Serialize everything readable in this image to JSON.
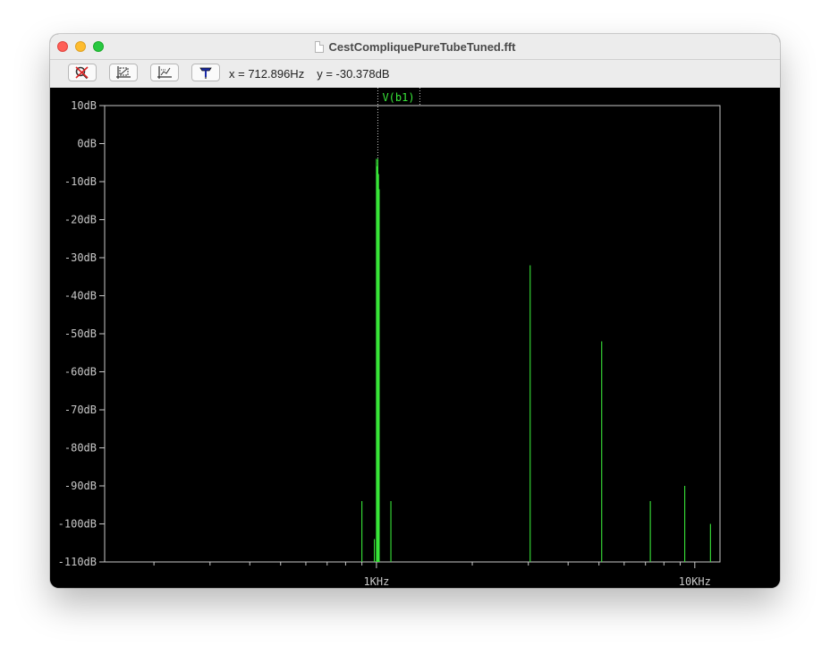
{
  "window": {
    "title": "CestCompliquePureTubeTuned.fft"
  },
  "toolbar": {
    "buttons": [
      {
        "icon": "zoom-cancel-icon"
      },
      {
        "icon": "autorange-icon"
      },
      {
        "icon": "zoom-fit-icon"
      },
      {
        "icon": "probe-icon"
      }
    ],
    "cursor_x": "x = 712.896Hz",
    "cursor_y": "y = -30.378dB"
  },
  "colors": {
    "background": "#000000",
    "trace": "#39e639",
    "axes": "#c8c8c8"
  },
  "chart_data": {
    "type": "bar",
    "title": "",
    "trace_label": "V(b1)",
    "xscale": "log",
    "xlim_hz": [
      140,
      12000
    ],
    "ylim_db": [
      -110,
      10
    ],
    "yticks": [
      {
        "value": 10,
        "label": "10dB"
      },
      {
        "value": 0,
        "label": "0dB"
      },
      {
        "value": -10,
        "label": "-10dB"
      },
      {
        "value": -20,
        "label": "-20dB"
      },
      {
        "value": -30,
        "label": "-30dB"
      },
      {
        "value": -40,
        "label": "-40dB"
      },
      {
        "value": -50,
        "label": "-50dB"
      },
      {
        "value": -60,
        "label": "-60dB"
      },
      {
        "value": -70,
        "label": "-70dB"
      },
      {
        "value": -80,
        "label": "-80dB"
      },
      {
        "value": -90,
        "label": "-90dB"
      },
      {
        "value": -100,
        "label": "-100dB"
      },
      {
        "value": -110,
        "label": "-110dB"
      }
    ],
    "xticks_labeled": [
      {
        "value": 1000,
        "label": "1KHz"
      },
      {
        "value": 10000,
        "label": "10KHz"
      }
    ],
    "xticks_minor": [
      200,
      300,
      400,
      500,
      600,
      700,
      800,
      900,
      2000,
      3000,
      4000,
      5000,
      6000,
      7000,
      8000,
      9000
    ],
    "cursor_freq_hz": 1010,
    "peaks": [
      {
        "freq": 900,
        "db": -94
      },
      {
        "freq": 985,
        "db": -104
      },
      {
        "freq": 1000,
        "db": -4
      },
      {
        "freq": 1005,
        "db": -6
      },
      {
        "freq": 1010,
        "db": -4
      },
      {
        "freq": 1015,
        "db": -8
      },
      {
        "freq": 1020,
        "db": -12
      },
      {
        "freq": 1110,
        "db": -94
      },
      {
        "freq": 3040,
        "db": -32
      },
      {
        "freq": 5100,
        "db": -52
      },
      {
        "freq": 7250,
        "db": -94
      },
      {
        "freq": 9300,
        "db": -90
      },
      {
        "freq": 11200,
        "db": -100
      }
    ]
  }
}
